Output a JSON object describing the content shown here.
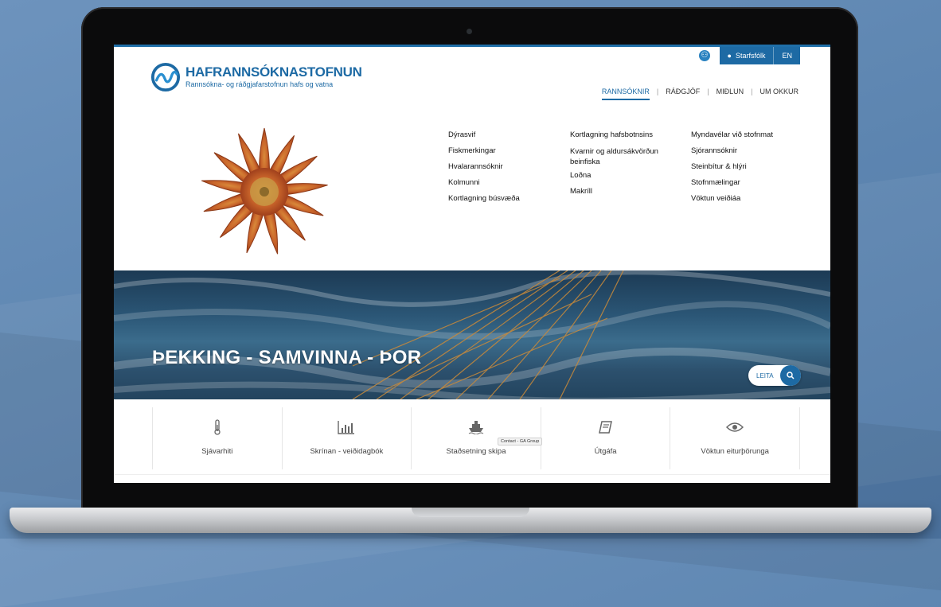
{
  "header": {
    "logo_title": "HAFRANNSÓKNASTOFNUN",
    "logo_subtitle": "Rannsókna- og ráðgjafarstofnun hafs og vatna",
    "staff_label": "Starfsfólk",
    "lang_label": "EN"
  },
  "nav": {
    "items": [
      "RANNSÓKNIR",
      "RÁÐGJÖF",
      "MIÐLUN",
      "UM OKKUR"
    ],
    "active": "RANNSÓKNIR"
  },
  "mega_menu": {
    "col1": [
      "Dýrasvif",
      "Fiskmerkingar",
      "Hvalarannsóknir",
      "Kolmunni",
      "Kortlagning búsvæða"
    ],
    "col2": [
      "Kortlagning hafsbotnsins",
      "Kvarnir og aldursákvörðun beinfiska",
      "Loðna",
      "Makríll"
    ],
    "col3": [
      "Myndavélar við stofnmat",
      "Sjórannsóknir",
      "Steinbítur & hlýri",
      "Stofnmælingar",
      "Vöktun veiðiáa"
    ]
  },
  "hero": {
    "title": "ÞEKKING - SAMVINNA - ÞOR",
    "search_label": "LEITA"
  },
  "quick_links": [
    {
      "label": "Sjávarhiti",
      "icon": "thermometer-icon"
    },
    {
      "label": "Skrínan - veiðidagbók",
      "icon": "bar-chart-icon"
    },
    {
      "label": "Staðsetning skipa",
      "icon": "ship-icon"
    },
    {
      "label": "Útgáfa",
      "icon": "book-icon"
    },
    {
      "label": "Vöktun eiturþörunga",
      "icon": "eye-icon"
    }
  ],
  "tooltip": "Contact - GA Group",
  "colors": {
    "brand": "#1d6aa4",
    "background": "#6389b4"
  }
}
